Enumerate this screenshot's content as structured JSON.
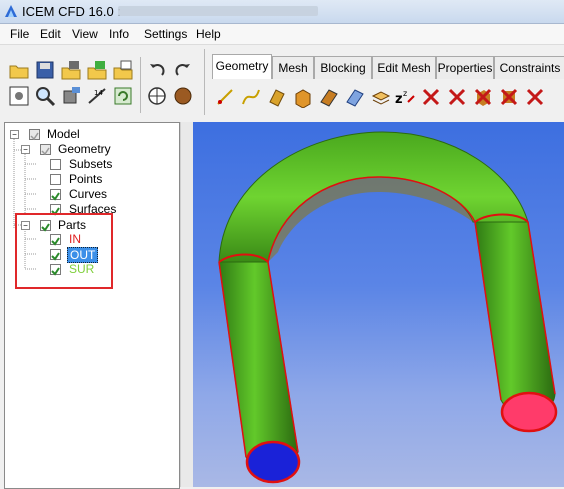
{
  "window": {
    "title": "ICEM CFD 16.0 :"
  },
  "menu": [
    "File",
    "Edit",
    "View",
    "Info",
    "Settings",
    "Help"
  ],
  "tabs": [
    "Geometry",
    "Mesh",
    "Blocking",
    "Edit Mesh",
    "Properties",
    "Constraints"
  ],
  "tree": {
    "model": "Model",
    "geometry": "Geometry",
    "subsets": "Subsets",
    "points": "Points",
    "curves": "Curves",
    "surfaces": "Surfaces",
    "parts": "Parts",
    "part_in": "IN",
    "part_out": "OUT",
    "part_sur": "SUR"
  },
  "colors": {
    "in": "#e02020",
    "out_bg": "#3b8fe8",
    "sur": "#7fcf3b",
    "highlight": "#e0282a"
  },
  "icons": {
    "toolbar": [
      "open-icon",
      "save-icon",
      "save-geometry-icon",
      "save-mesh-icon",
      "save-blocking-icon",
      "undo-icon",
      "redo-icon",
      "fit-window-icon",
      "zoom-icon",
      "measure-icon",
      "distance-icon",
      "refresh-icon",
      "wireframe-icon",
      "solid-icon"
    ],
    "geometry_tools": [
      "create-point-icon",
      "create-curve-icon",
      "create-surface-icon",
      "create-body-icon",
      "repair-geometry-icon",
      "transform-geometry-icon",
      "restore-icon",
      "faceted-icon",
      "delete-point-icon",
      "delete-curve-icon",
      "delete-surface-icon",
      "delete-body-icon",
      "delete-any-icon"
    ]
  }
}
